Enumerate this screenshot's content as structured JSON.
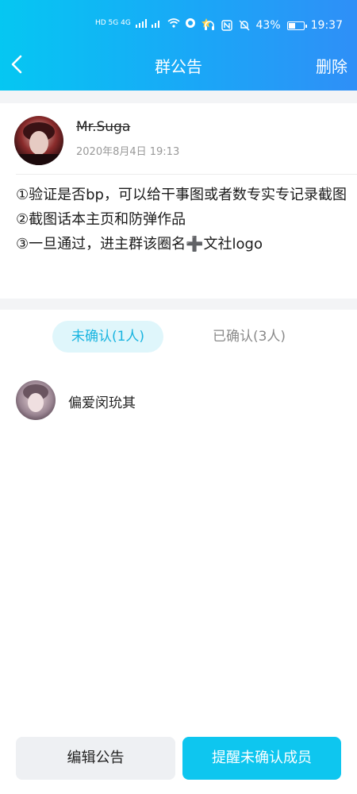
{
  "status_bar": {
    "network_left": "HD 5G 4G",
    "battery_percent": "43%",
    "battery_level": 0.43,
    "time": "19:37"
  },
  "nav": {
    "title": "群公告",
    "delete_label": "删除"
  },
  "post": {
    "author": "Mr.Suga",
    "time": "2020年8月4日 19:13",
    "lines": [
      "①验证是否bp，可以给干事图或者数专实专记录截图",
      "②截图话本主页和防弹作品",
      "③一旦通过，进主群该圈名➕文社logo"
    ]
  },
  "tabs": {
    "unconfirmed": "未确认(1人)",
    "confirmed": "已确认(3人)"
  },
  "members": [
    {
      "name": "偏爱闵玧其"
    }
  ],
  "actions": {
    "edit_label": "编辑公告",
    "remind_label": "提醒未确认成员"
  },
  "colors": {
    "header_start": "#05c7f2",
    "header_end": "#2f8ff7",
    "accent": "#0ec6ef",
    "tab_active_bg": "#dff6fb"
  }
}
